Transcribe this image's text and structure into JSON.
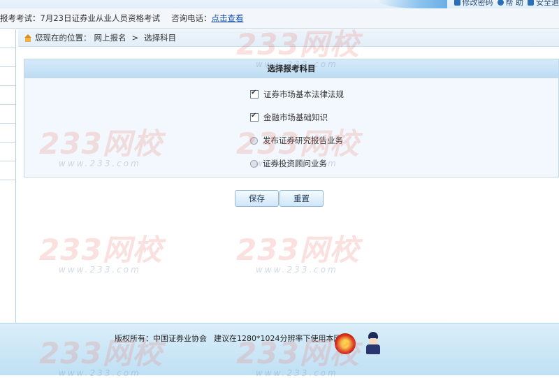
{
  "header": {
    "links": [
      {
        "label": "修改密码",
        "icon": "edit-icon"
      },
      {
        "label": "帮 助",
        "icon": "help-icon"
      },
      {
        "label": "安全退",
        "icon": "logout-icon"
      }
    ]
  },
  "infobar": {
    "exam_text": "报考考试：7月23日证券业从业人员资格考试",
    "phone_label": "咨询电话：",
    "phone_link": "点击查看"
  },
  "breadcrumb": {
    "prefix": "您现在的位置：",
    "items": [
      "网上报名",
      "选择科目"
    ],
    "separator": ">"
  },
  "panel": {
    "title": "选择报考科目",
    "options": [
      {
        "label": "证券市场基本法律法规",
        "control": "checkbox",
        "checked": true
      },
      {
        "label": "金融市场基础知识",
        "control": "checkbox",
        "checked": true
      },
      {
        "label": "发布证券研究报告业务",
        "control": "radio",
        "checked": false
      },
      {
        "label": "证券投资顾问业务",
        "control": "radio",
        "checked": false
      }
    ]
  },
  "buttons": {
    "save": "保存",
    "reset": "重置"
  },
  "footer": {
    "copyright": "版权所有：中国证券业协会",
    "recommend": "建议在1280*1024分辨率下使用本网站"
  },
  "watermark": {
    "brand": "233网校",
    "url": "www.233.com"
  }
}
